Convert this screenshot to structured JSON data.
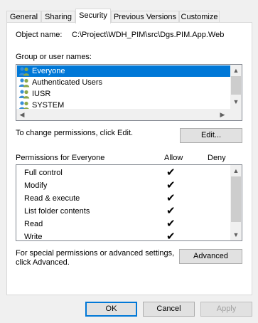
{
  "tabs": [
    "General",
    "Sharing",
    "Security",
    "Previous Versions",
    "Customize"
  ],
  "object": {
    "label": "Object name:",
    "value": "C:\\Project\\WDH_PIM\\src\\Dgs.PIM.App.Web"
  },
  "groups": {
    "label": "Group or user names:",
    "users": [
      "Everyone",
      "Authenticated Users",
      "IUSR",
      "SYSTEM"
    ],
    "selected_index": 0
  },
  "change_text": "To change permissions, click Edit.",
  "edit_button": "Edit...",
  "permissions": {
    "header": "Permissions for Everyone",
    "allow_header": "Allow",
    "deny_header": "Deny",
    "rows": [
      {
        "name": "Full control",
        "allow": true,
        "deny": false
      },
      {
        "name": "Modify",
        "allow": true,
        "deny": false
      },
      {
        "name": "Read & execute",
        "allow": true,
        "deny": false
      },
      {
        "name": "List folder contents",
        "allow": true,
        "deny": false
      },
      {
        "name": "Read",
        "allow": true,
        "deny": false
      },
      {
        "name": "Write",
        "allow": true,
        "deny": false
      }
    ]
  },
  "special_text": [
    "For special permissions or advanced settings,",
    "click Advanced."
  ],
  "advanced_button": "Advanced",
  "footer": {
    "ok": "OK",
    "cancel": "Cancel",
    "apply": "Apply"
  },
  "colors": {
    "selection": "#0078d7",
    "accent_border": "#0078d7"
  },
  "icons": {
    "user_group": "users-icon",
    "check": "check-icon"
  }
}
